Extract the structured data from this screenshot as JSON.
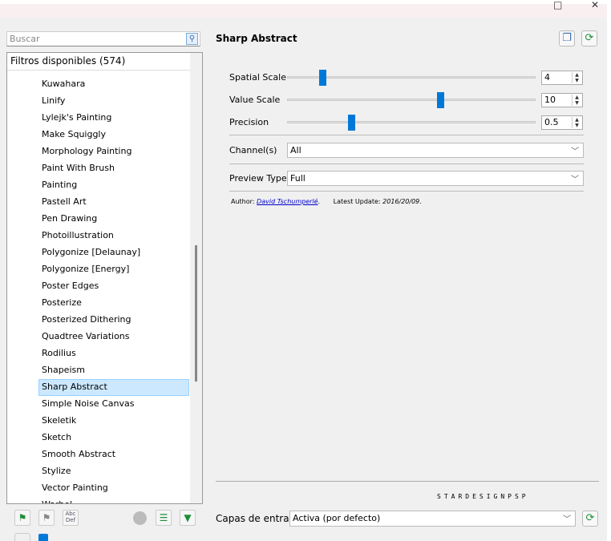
{
  "window": {
    "maximize_glyph": "□",
    "close_glyph": "✕"
  },
  "search": {
    "placeholder": "Buscar"
  },
  "filters": {
    "header": "Filtros disponibles (574)",
    "items": [
      "Kuwahara",
      "Linify",
      "Lylejk's Painting",
      "Make Squiggly",
      "Morphology Painting",
      "Paint With Brush",
      "Painting",
      "Pastell Art",
      "Pen Drawing",
      "Photoillustration",
      "Polygonize [Delaunay]",
      "Polygonize [Energy]",
      "Poster Edges",
      "Posterize",
      "Posterized Dithering",
      "Quadtree Variations",
      "Rodilius",
      "Shapeism",
      "Sharp Abstract",
      "Simple Noise Canvas",
      "Skeletik",
      "Sketch",
      "Smooth Abstract",
      "Stylize",
      "Vector Painting",
      "Warhol"
    ],
    "selected": "Sharp Abstract"
  },
  "panel": {
    "title": "Sharp Abstract",
    "params": [
      {
        "label": "Spatial Scale",
        "value": "4",
        "fraction": 0.13
      },
      {
        "label": "Value Scale",
        "value": "10",
        "fraction": 0.62
      },
      {
        "label": "Precision",
        "value": "0.5",
        "fraction": 0.25
      }
    ],
    "channels": {
      "label": "Channel(s)",
      "value": "All"
    },
    "preview": {
      "label": "Preview Type",
      "value": "Full"
    },
    "author_label": "Author:",
    "author": "David Tschumperlé",
    "update_label": "Latest Update:",
    "update": "2016/20/09",
    "watermark": "STARDESIGNPSP",
    "input_layers": {
      "label": "Capas de entrada",
      "value": "Activa (por defecto)"
    }
  },
  "colors": {
    "accent": "#0078d7",
    "selection": "#cce8ff",
    "green": "#1e8f3a"
  }
}
